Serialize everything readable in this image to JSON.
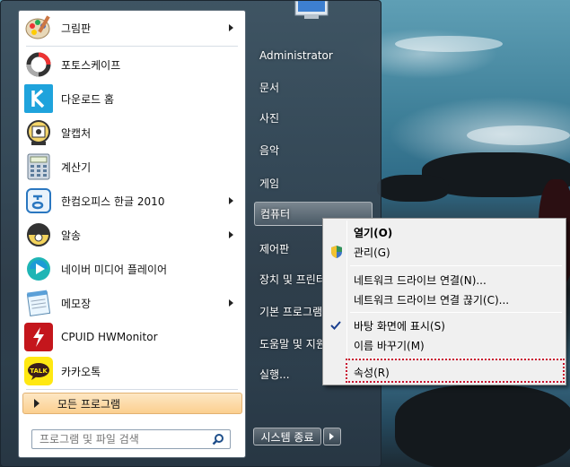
{
  "start_menu": {
    "programs": [
      {
        "label": "그림판",
        "icon": "paint-icon",
        "submenu": true
      },
      {
        "label": "포토스케이프",
        "icon": "photoscape-icon",
        "submenu": false
      },
      {
        "label": "다운로드 홈",
        "icon": "download-home-icon",
        "submenu": false
      },
      {
        "label": "알캡처",
        "icon": "alcapture-icon",
        "submenu": false
      },
      {
        "label": "계산기",
        "icon": "calculator-icon",
        "submenu": false
      },
      {
        "label": "한컴오피스 한글 2010",
        "icon": "hancom-icon",
        "submenu": true
      },
      {
        "label": "알송",
        "icon": "alsong-icon",
        "submenu": true
      },
      {
        "label": "네이버 미디어 플레이어",
        "icon": "naver-media-player-icon",
        "submenu": false
      },
      {
        "label": "메모장",
        "icon": "notepad-icon",
        "submenu": true
      },
      {
        "label": "CPUID HWMonitor",
        "icon": "hwmonitor-icon",
        "submenu": false
      },
      {
        "label": "카카오톡",
        "icon": "kakaotalk-icon",
        "submenu": false
      }
    ],
    "kakao_badge": "TALK",
    "all_programs": "모든 프로그램",
    "search_placeholder": "프로그램 및 파일 검색",
    "right_items": [
      "Administrator",
      "문서",
      "사진",
      "음악",
      "게임",
      "컴퓨터",
      "제어판",
      "장치 및 프린터",
      "기본 프로그램",
      "도움말 및 지원",
      "실행..."
    ],
    "shutdown_label": "시스템 종료"
  },
  "context_menu": {
    "items": [
      {
        "label": "열기(O)",
        "bold": true
      },
      {
        "label": "관리(G)",
        "icon": "shield-icon"
      },
      {
        "label": "네트워크 드라이브 연결(N)..."
      },
      {
        "label": "네트워크 드라이브 연결 끊기(C)..."
      },
      {
        "label": "바탕 화면에 표시(S)",
        "checked": true
      },
      {
        "label": "이름 바꾸기(M)"
      },
      {
        "label": "속성(R)",
        "highlighted": true
      }
    ]
  },
  "colors": {
    "highlight_border": "#c8102e",
    "all_programs_bg": "#fbcf8f"
  }
}
